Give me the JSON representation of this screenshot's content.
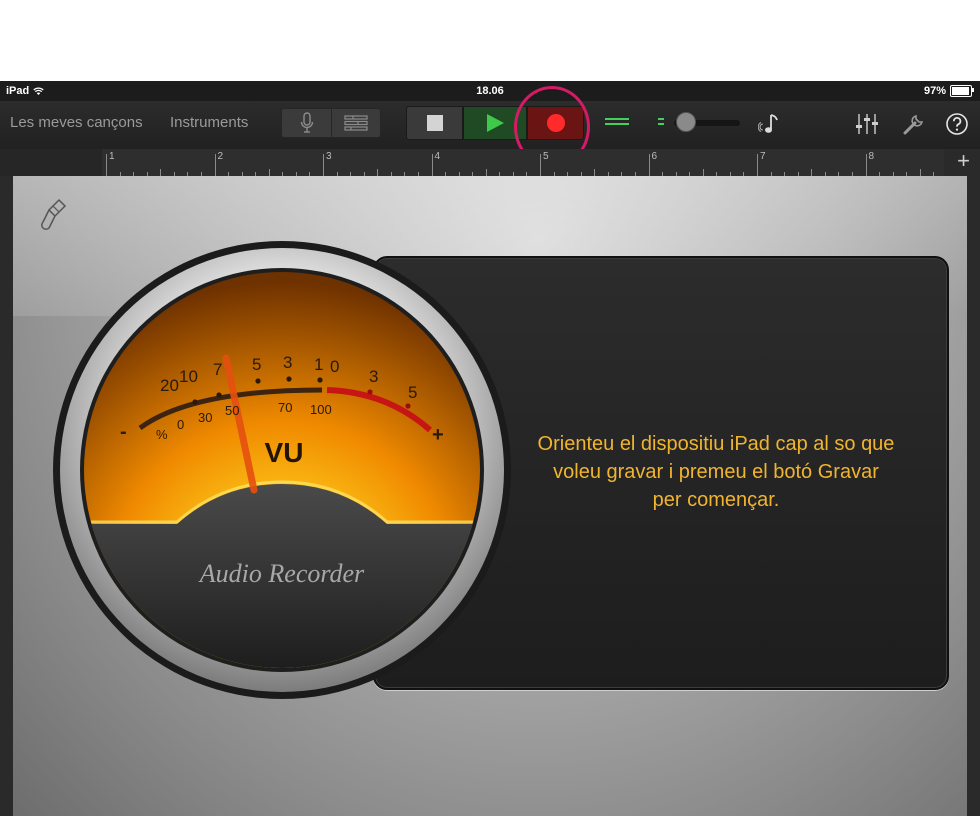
{
  "status_bar": {
    "carrier": "iPad",
    "time": "18.06",
    "battery": "97%"
  },
  "toolbar": {
    "my_songs": "Les meves cançons",
    "instruments": "Instruments",
    "mic_icon": "microphone-icon",
    "tracks_icon": "tracks-view-icon",
    "stop_icon": "stop-icon",
    "play_icon": "play-icon",
    "record_icon": "record-icon",
    "loops_icon": "music-note-icon",
    "mixer_icon": "mixer-sliders-icon",
    "settings_icon": "wrench-icon",
    "help_icon": "help-icon",
    "accent_play": "#3ec94a",
    "accent_record": "#ff2b2b",
    "highlight_ring": "#d61a66"
  },
  "ruler": {
    "bars": [
      "1",
      "2",
      "3",
      "4",
      "5",
      "6",
      "7",
      "8"
    ],
    "add_label": "+"
  },
  "vu_meter": {
    "title": "VU",
    "subtitle": "Audio Recorder",
    "db_scale": [
      "20",
      "10",
      "7",
      "5",
      "3",
      "1",
      "0",
      "3",
      "5"
    ],
    "percent_label": "%",
    "percent_scale": [
      "0",
      "30",
      "50",
      "70",
      "100"
    ],
    "minus": "-",
    "plus": "+"
  },
  "message": "Orienteu el dispositiu iPad cap al so que voleu gravar i premeu el botó Gravar per començar."
}
